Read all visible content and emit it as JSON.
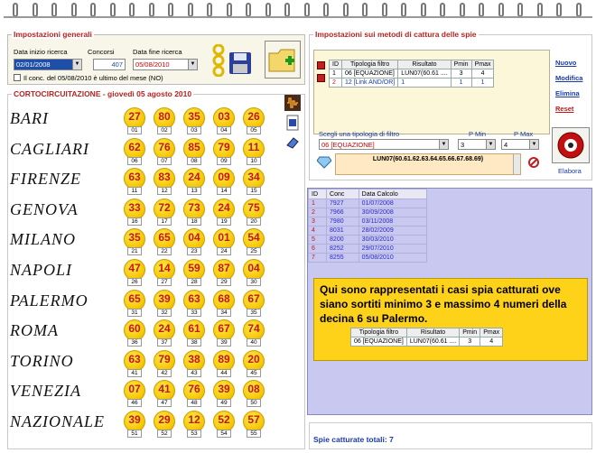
{
  "general": {
    "legend": "Impostazioni generali",
    "start_label": "Data inizio ricerca",
    "start_value": "02/01/2008",
    "concorsi_label": "Concorsi",
    "concorsi_value": "407",
    "end_label": "Data fine ricerca",
    "end_value": "05/08/2010",
    "check_label": "Il conc. del 05/08/2010 è ultimo del mese (NO)"
  },
  "corto": {
    "title": "CORTOCIRCUITAZIONE - giovedì 05 agosto 2010",
    "rows": [
      {
        "city": "BARI",
        "nums": [
          "27",
          "80",
          "35",
          "03",
          "26"
        ],
        "pos": [
          "01",
          "02",
          "03",
          "04",
          "05"
        ]
      },
      {
        "city": "CAGLIARI",
        "nums": [
          "62",
          "76",
          "85",
          "79",
          "11"
        ],
        "pos": [
          "06",
          "07",
          "08",
          "09",
          "10"
        ]
      },
      {
        "city": "FIRENZE",
        "nums": [
          "63",
          "83",
          "24",
          "09",
          "34"
        ],
        "pos": [
          "11",
          "12",
          "13",
          "14",
          "15"
        ]
      },
      {
        "city": "GENOVA",
        "nums": [
          "33",
          "72",
          "73",
          "24",
          "75"
        ],
        "pos": [
          "16",
          "17",
          "18",
          "19",
          "20"
        ]
      },
      {
        "city": "MILANO",
        "nums": [
          "35",
          "65",
          "04",
          "01",
          "54"
        ],
        "pos": [
          "21",
          "22",
          "23",
          "24",
          "25"
        ]
      },
      {
        "city": "NAPOLI",
        "nums": [
          "47",
          "14",
          "59",
          "87",
          "04"
        ],
        "pos": [
          "26",
          "27",
          "28",
          "29",
          "30"
        ]
      },
      {
        "city": "PALERMO",
        "nums": [
          "65",
          "39",
          "63",
          "68",
          "67"
        ],
        "pos": [
          "31",
          "32",
          "33",
          "34",
          "35"
        ]
      },
      {
        "city": "ROMA",
        "nums": [
          "60",
          "24",
          "61",
          "67",
          "74"
        ],
        "pos": [
          "36",
          "37",
          "38",
          "39",
          "40"
        ]
      },
      {
        "city": "TORINO",
        "nums": [
          "63",
          "79",
          "38",
          "89",
          "20"
        ],
        "pos": [
          "41",
          "42",
          "43",
          "44",
          "45"
        ]
      },
      {
        "city": "VENEZIA",
        "nums": [
          "07",
          "41",
          "76",
          "39",
          "08"
        ],
        "pos": [
          "46",
          "47",
          "48",
          "49",
          "50"
        ]
      },
      {
        "city": "NAZIONALE",
        "nums": [
          "39",
          "29",
          "12",
          "52",
          "57"
        ],
        "pos": [
          "51",
          "52",
          "53",
          "54",
          "55"
        ]
      }
    ]
  },
  "spy": {
    "legend": "Impostazioni sui metodi di cattura delle spie",
    "headers": [
      "ID",
      "Tipologia filtro",
      "Risultato",
      "Pmin",
      "Pmax"
    ],
    "rows": [
      {
        "id": "1",
        "tipo": "06 [EQUAZIONE]",
        "ris": "LUN07(60.61 ....",
        "pmin": "3",
        "pmax": "4"
      },
      {
        "id": "2",
        "tipo": "12 [Link AND/OR]",
        "ris": "1",
        "pmin": "1",
        "pmax": "1"
      }
    ],
    "links": {
      "nuovo": "Nuovo",
      "modifica": "Modifica",
      "elimina": "Elimina",
      "reset": "Reset"
    },
    "filter_label": "Scegli una tipologia di filtro",
    "filter_value": "06 [EQUAZIONE]",
    "pmin_label": "P Min",
    "pmin_value": "3",
    "pmax_label": "P Max",
    "pmax_value": "4",
    "formula": "LUN07(60.61.62.63.64.65.66.67.68.69)",
    "elabora": "Elabora"
  },
  "history": {
    "headers": [
      "ID",
      "Conc",
      "Data Calcolo"
    ],
    "rows": [
      {
        "id": "1",
        "conc": "7927",
        "data": "01/07/2008"
      },
      {
        "id": "2",
        "conc": "7966",
        "data": "30/09/2008"
      },
      {
        "id": "3",
        "conc": "7980",
        "data": "03/11/2008"
      },
      {
        "id": "4",
        "conc": "8031",
        "data": "28/02/2009"
      },
      {
        "id": "5",
        "conc": "8200",
        "data": "30/03/2010"
      },
      {
        "id": "6",
        "conc": "8252",
        "data": "29/07/2010"
      },
      {
        "id": "7",
        "conc": "8255",
        "data": "05/08/2010"
      }
    ]
  },
  "note": {
    "text": "Qui sono rappresentati i casi spia catturati ove siano sortiti minimo 3 e massimo 4 numeri della decina 6 su Palermo.",
    "headers": [
      "Tipologia filtro",
      "Risultato",
      "Pmin",
      "Pmax"
    ],
    "row": {
      "tipo": "06 [EQUAZIONE]",
      "ris": "LUN07(60.61 ....",
      "pmin": "3",
      "pmax": "4"
    }
  },
  "footer": {
    "total": "Spie catturate totali: 7"
  }
}
